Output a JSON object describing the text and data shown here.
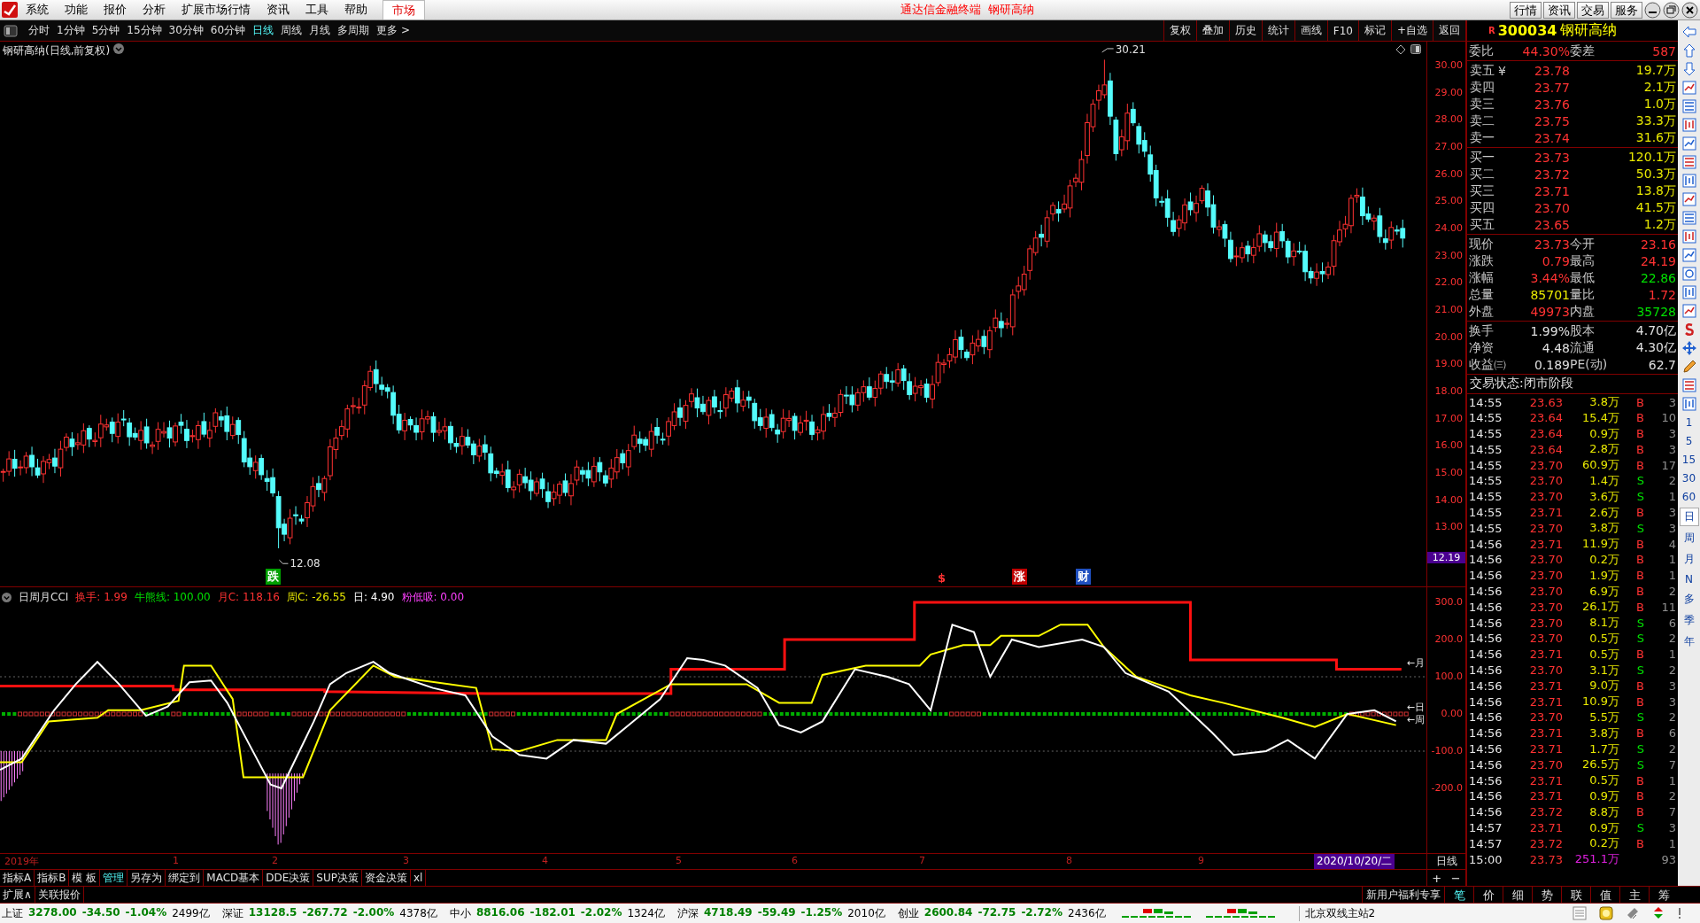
{
  "title_bar": {
    "menus": [
      "系统",
      "功能",
      "报价",
      "分析",
      "扩展市场行情",
      "资讯",
      "工具",
      "帮助"
    ],
    "market_tab": "市场",
    "title": "通达信金融终端  钢研高纳",
    "buttons": [
      "行情",
      "资讯",
      "交易",
      "服务"
    ]
  },
  "period_bar": {
    "periods": [
      {
        "label": "分时",
        "selected": false
      },
      {
        "label": "1分钟",
        "selected": false
      },
      {
        "label": "5分钟",
        "selected": false
      },
      {
        "label": "15分钟",
        "selected": false
      },
      {
        "label": "30分钟",
        "selected": false
      },
      {
        "label": "60分钟",
        "selected": false
      },
      {
        "label": "日线",
        "selected": true
      },
      {
        "label": "周线",
        "selected": false
      },
      {
        "label": "月线",
        "selected": false
      },
      {
        "label": "多周期",
        "selected": false
      }
    ],
    "more": "更多 >",
    "tools": [
      "复权",
      "叠加",
      "历史",
      "统计",
      "画线",
      "F10",
      "标记",
      "+自选",
      "返回"
    ]
  },
  "chart": {
    "title": "钢研高纳(日线,前复权)",
    "high_label": "30.21",
    "low_label": "12.08",
    "price_axis": [
      "30.00",
      "29.00",
      "28.00",
      "27.00",
      "26.00",
      "25.00",
      "24.00",
      "23.00",
      "22.00",
      "21.00",
      "20.00",
      "19.00",
      "18.00",
      "17.00",
      "16.00",
      "15.00",
      "14.00",
      "13.00"
    ],
    "price_tag": "12.19",
    "event_marks": [
      {
        "text": "跌",
        "kind": "box",
        "color": "#00a000"
      },
      {
        "text": "$",
        "kind": "plain",
        "color": "#ff3232"
      },
      {
        "text": "涨",
        "kind": "box",
        "color": "#c00000"
      },
      {
        "text": "财",
        "kind": "box",
        "color": "#2050c0"
      }
    ]
  },
  "indicator": {
    "name": "日周月CCI",
    "values": [
      {
        "label": "换手: ",
        "value": "1.99",
        "color": "#ff3232"
      },
      {
        "label": "牛熊线: ",
        "value": "100.00",
        "color": "#00e000"
      },
      {
        "label": "月C: ",
        "value": "118.16",
        "color": "#ff3232"
      },
      {
        "label": "周C: ",
        "value": "-26.55",
        "color": "#e8e800"
      },
      {
        "label": "日: ",
        "value": "4.90",
        "color": "#ffffff"
      },
      {
        "label": "粉低吸: ",
        "value": "0.00",
        "color": "#ff40ff"
      }
    ],
    "axis": [
      "300.0",
      "200.0",
      "100.0",
      "0.00",
      "-100.0",
      "-200.0"
    ],
    "line_tags": [
      "←月",
      "←日",
      "←周"
    ]
  },
  "date_axis": {
    "labels": [
      "2019年",
      "1",
      "2",
      "3",
      "4",
      "5",
      "6",
      "7",
      "8",
      "9"
    ],
    "cursor_date": "2020/10/20/二",
    "period": "日线",
    "zoom": [
      "+",
      "−"
    ]
  },
  "bottom_tabs": {
    "tabs": [
      {
        "label": "指标A",
        "selected": false
      },
      {
        "label": "指标B",
        "selected": false
      },
      {
        "label": "模 板",
        "selected": false
      },
      {
        "label": "管理",
        "selected": true
      },
      {
        "label": "另存为",
        "selected": false
      },
      {
        "label": "绑定到",
        "selected": false
      },
      {
        "label": "MACD基本",
        "selected": false
      },
      {
        "label": "DDE决策",
        "selected": false
      },
      {
        "label": "SUP决策",
        "selected": false
      },
      {
        "label": "资金决策",
        "selected": false
      },
      {
        "label": "xl",
        "selected": false
      }
    ],
    "row2": [
      "扩展∧",
      "关联报价"
    ],
    "promo": "新用户福利专享",
    "panel_tabs": [
      {
        "label": "笔",
        "selected": true
      },
      {
        "label": "价",
        "selected": false
      },
      {
        "label": "细",
        "selected": false
      },
      {
        "label": "势",
        "selected": false
      },
      {
        "label": "联",
        "selected": false
      },
      {
        "label": "值",
        "selected": false
      },
      {
        "label": "主",
        "selected": false
      },
      {
        "label": "筹",
        "selected": false
      }
    ]
  },
  "quote": {
    "badge": "R",
    "code": "300034",
    "name": "钢研高纳",
    "ratio": [
      {
        "text": "委比"
      },
      {
        "text": "44.30%",
        "color": "#ff3232"
      },
      {
        "text": "委差"
      },
      {
        "text": "587",
        "color": "#ff3232"
      }
    ],
    "asks": [
      {
        "label": "卖五",
        "mark": "¥",
        "price": "23.78",
        "volume": "19.7万"
      },
      {
        "label": "卖四",
        "price": "23.77",
        "volume": "2.1万"
      },
      {
        "label": "卖三",
        "price": "23.76",
        "volume": "1.0万"
      },
      {
        "label": "卖二",
        "price": "23.75",
        "volume": "33.3万"
      },
      {
        "label": "卖一",
        "price": "23.74",
        "volume": "31.6万"
      }
    ],
    "bids": [
      {
        "label": "买一",
        "price": "23.73",
        "volume": "120.1万"
      },
      {
        "label": "买二",
        "price": "23.72",
        "volume": "50.3万"
      },
      {
        "label": "买三",
        "price": "23.71",
        "volume": "13.8万"
      },
      {
        "label": "买四",
        "price": "23.70",
        "volume": "41.5万"
      },
      {
        "label": "买五",
        "price": "23.65",
        "volume": "1.2万"
      }
    ],
    "stats": [
      [
        {
          "text": "现价",
          "color": "#c8c8c8"
        },
        {
          "text": "23.73",
          "color": "#ff3232"
        },
        {
          "text": "今开",
          "color": "#c8c8c8"
        },
        {
          "text": "23.16",
          "color": "#ff3232"
        }
      ],
      [
        {
          "text": "涨跌",
          "color": "#c8c8c8"
        },
        {
          "text": "0.79",
          "color": "#ff3232"
        },
        {
          "text": "最高",
          "color": "#c8c8c8"
        },
        {
          "text": "24.19",
          "color": "#ff3232"
        }
      ],
      [
        {
          "text": "涨幅",
          "color": "#c8c8c8"
        },
        {
          "text": "3.44%",
          "color": "#ff3232"
        },
        {
          "text": "最低",
          "color": "#c8c8c8"
        },
        {
          "text": "22.86",
          "color": "#00e000"
        }
      ],
      [
        {
          "text": "总量",
          "color": "#c8c8c8"
        },
        {
          "text": "85701",
          "color": "#e8e800"
        },
        {
          "text": "量比",
          "color": "#c8c8c8"
        },
        {
          "text": "1.72",
          "color": "#ff3232"
        }
      ],
      [
        {
          "text": "外盘",
          "color": "#c8c8c8"
        },
        {
          "text": "49973",
          "color": "#ff3232"
        },
        {
          "text": "内盘",
          "color": "#c8c8c8"
        },
        {
          "text": "35728",
          "color": "#00e000"
        }
      ]
    ],
    "info": [
      [
        {
          "text": "换手",
          "color": "#c8c8c8"
        },
        {
          "text": "1.99%",
          "color": "#e0e0e0"
        },
        {
          "text": "股本",
          "color": "#c8c8c8"
        },
        {
          "text": "4.70亿",
          "color": "#e0e0e0"
        }
      ],
      [
        {
          "text": "净资",
          "color": "#c8c8c8"
        },
        {
          "text": "4.48",
          "color": "#e0e0e0"
        },
        {
          "text": "流通",
          "color": "#c8c8c8"
        },
        {
          "text": "4.30亿",
          "color": "#e0e0e0"
        }
      ],
      [
        {
          "text": "收益㈢",
          "color": "#c8c8c8"
        },
        {
          "text": "0.189",
          "color": "#e0e0e0"
        },
        {
          "text": "PE(动)",
          "color": "#c8c8c8"
        },
        {
          "text": "62.7",
          "color": "#e0e0e0"
        }
      ]
    ],
    "status": "交易状态:闭市阶段"
  },
  "trades": [
    {
      "time": "14:55",
      "price": "23.63",
      "volume": "3.8万",
      "side": "B",
      "count": "3"
    },
    {
      "time": "14:55",
      "price": "23.64",
      "volume": "15.4万",
      "side": "B",
      "count": "10"
    },
    {
      "time": "14:55",
      "price": "23.64",
      "volume": "0.9万",
      "side": "B",
      "count": "3"
    },
    {
      "time": "14:55",
      "price": "23.64",
      "volume": "2.8万",
      "side": "B",
      "count": "3"
    },
    {
      "time": "14:55",
      "price": "23.70",
      "volume": "60.9万",
      "side": "B",
      "count": "17"
    },
    {
      "time": "14:55",
      "price": "23.70",
      "volume": "1.4万",
      "side": "S",
      "count": "2"
    },
    {
      "time": "14:55",
      "price": "23.70",
      "volume": "3.6万",
      "side": "S",
      "count": "1"
    },
    {
      "time": "14:55",
      "price": "23.71",
      "volume": "2.6万",
      "side": "B",
      "count": "3"
    },
    {
      "time": "14:55",
      "price": "23.70",
      "volume": "3.8万",
      "side": "S",
      "count": "3"
    },
    {
      "time": "14:56",
      "price": "23.71",
      "volume": "11.9万",
      "side": "B",
      "count": "4"
    },
    {
      "time": "14:56",
      "price": "23.70",
      "volume": "0.2万",
      "side": "B",
      "count": "1"
    },
    {
      "time": "14:56",
      "price": "23.70",
      "volume": "1.9万",
      "side": "B",
      "count": "1"
    },
    {
      "time": "14:56",
      "price": "23.70",
      "volume": "6.9万",
      "side": "B",
      "count": "2"
    },
    {
      "time": "14:56",
      "price": "23.70",
      "volume": "26.1万",
      "side": "B",
      "count": "11"
    },
    {
      "time": "14:56",
      "price": "23.70",
      "volume": "8.1万",
      "side": "S",
      "count": "6"
    },
    {
      "time": "14:56",
      "price": "23.70",
      "volume": "0.5万",
      "side": "S",
      "count": "2"
    },
    {
      "time": "14:56",
      "price": "23.71",
      "volume": "0.5万",
      "side": "B",
      "count": "1"
    },
    {
      "time": "14:56",
      "price": "23.70",
      "volume": "3.1万",
      "side": "S",
      "count": "2"
    },
    {
      "time": "14:56",
      "price": "23.71",
      "volume": "9.0万",
      "side": "B",
      "count": "3"
    },
    {
      "time": "14:56",
      "price": "23.71",
      "volume": "10.9万",
      "side": "B",
      "count": "3"
    },
    {
      "time": "14:56",
      "price": "23.70",
      "volume": "5.5万",
      "side": "S",
      "count": "2"
    },
    {
      "time": "14:56",
      "price": "23.71",
      "volume": "3.8万",
      "side": "B",
      "count": "6"
    },
    {
      "time": "14:56",
      "price": "23.71",
      "volume": "1.7万",
      "side": "S",
      "count": "2"
    },
    {
      "time": "14:56",
      "price": "23.70",
      "volume": "26.5万",
      "side": "S",
      "count": "7"
    },
    {
      "time": "14:56",
      "price": "23.71",
      "volume": "0.5万",
      "side": "B",
      "count": "1"
    },
    {
      "time": "14:56",
      "price": "23.71",
      "volume": "0.9万",
      "side": "B",
      "count": "2"
    },
    {
      "time": "14:56",
      "price": "23.72",
      "volume": "8.8万",
      "side": "B",
      "count": "7"
    },
    {
      "time": "14:57",
      "price": "23.71",
      "volume": "0.9万",
      "side": "S",
      "count": "3"
    },
    {
      "time": "14:57",
      "price": "23.72",
      "volume": "0.2万",
      "side": "B",
      "count": "1"
    },
    {
      "time": "15:00",
      "price": "23.73",
      "volume": "251.1万",
      "kind": "total",
      "count": "93"
    }
  ],
  "side_toolbar": {
    "periods": [
      {
        "label": "1",
        "selected": false
      },
      {
        "label": "5",
        "selected": false
      },
      {
        "label": "15",
        "selected": false
      },
      {
        "label": "30",
        "selected": false
      },
      {
        "label": "60",
        "selected": false
      },
      {
        "label": "日",
        "selected": true
      },
      {
        "label": "周",
        "selected": false
      },
      {
        "label": "月",
        "selected": false
      },
      {
        "label": "N",
        "selected": false
      },
      {
        "label": "多",
        "selected": false
      },
      {
        "label": "季",
        "selected": false
      },
      {
        "label": "年",
        "selected": false
      }
    ]
  },
  "status_bar": {
    "indices": [
      {
        "name": "上证",
        "price": "3278.00",
        "change": "-34.50",
        "pct": "-1.04%",
        "amount": "2499亿"
      },
      {
        "name": "深证",
        "price": "13128.5",
        "change": "-267.72",
        "pct": "-2.00%",
        "amount": "4378亿"
      },
      {
        "name": "中小",
        "price": "8816.06",
        "change": "-182.01",
        "pct": "-2.02%",
        "amount": "1324亿"
      },
      {
        "name": "沪深",
        "price": "4718.49",
        "change": "-59.49",
        "pct": "-1.25%",
        "amount": "2010亿"
      },
      {
        "name": "创业",
        "price": "2600.84",
        "change": "-72.75",
        "pct": "-2.72%",
        "amount": "2436亿"
      }
    ],
    "server": "北京双线主站2"
  }
}
